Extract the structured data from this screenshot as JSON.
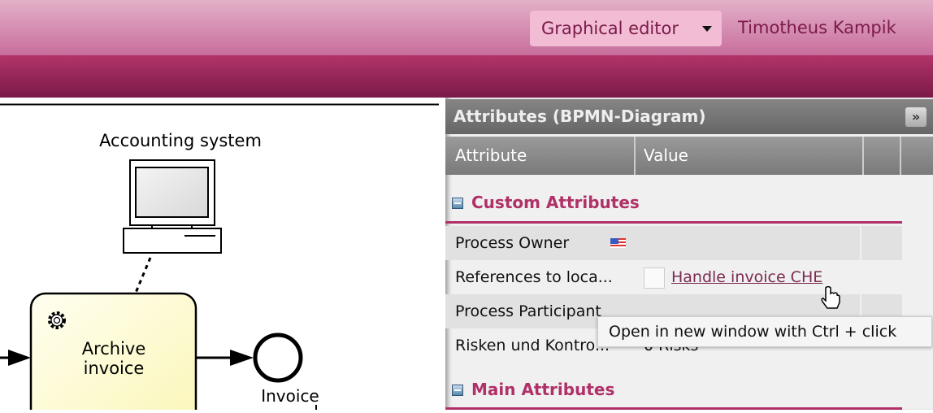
{
  "header": {
    "view_selector": "Graphical editor",
    "user_name": "Timotheus Kampik",
    "language_icon": "us-flag-icon"
  },
  "diagram": {
    "system_label": "Accounting system",
    "task_label_line1": "Archive invoice",
    "task_label": "Archive invoice",
    "end_event_label": "Invoice",
    "task_fill": "#fdfbc8"
  },
  "panel": {
    "title": "Attributes (BPMN-Diagram)",
    "collapse_label": "»",
    "columns": [
      "Attribute",
      "Value"
    ],
    "sections": [
      {
        "title": "Custom Attributes",
        "rows": [
          {
            "attribute": "Process Owner",
            "value": ""
          },
          {
            "attribute": "References to loca...",
            "value": "Handle invoice CHE"
          },
          {
            "attribute": "Process Participant",
            "value": ""
          },
          {
            "attribute": "Risken und Kontro...",
            "value": "0 Risks"
          }
        ]
      },
      {
        "title": "Main Attributes",
        "rows": []
      }
    ]
  },
  "tooltip": "Open in new window with Ctrl + click",
  "colors": {
    "accent": "#b03068",
    "header_text": "#7a1a48"
  }
}
